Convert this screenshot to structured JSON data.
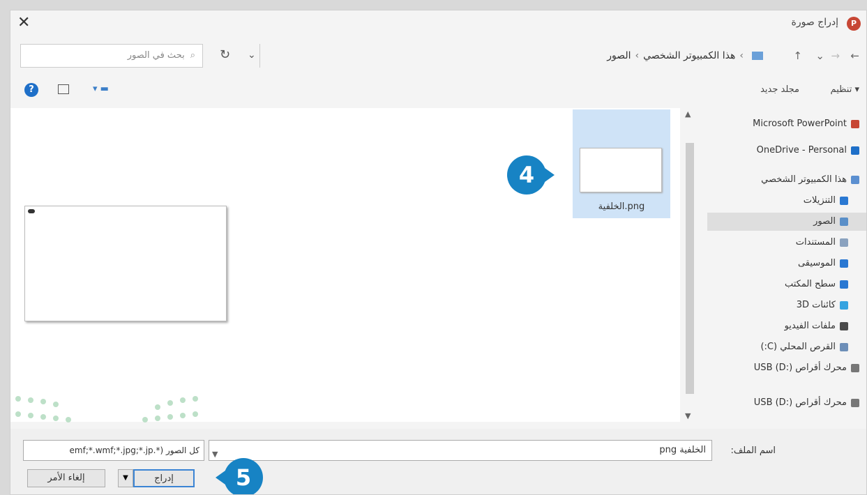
{
  "window": {
    "title": "إدراج صورة",
    "app_icon": "powerpoint-icon",
    "close_glyph": "✕"
  },
  "address": {
    "back": "←",
    "forward": "→",
    "recent": "⌄",
    "up": "↑",
    "path": [
      "هذا الكمبيوتر الشخصي",
      "الصور"
    ],
    "separator": "›",
    "dropdown": "⌄",
    "refresh": "↻",
    "search_placeholder": "بحث في الصور",
    "search_icon": "⌕"
  },
  "toolbar": {
    "organize": "تنظيم ▾",
    "new_folder": "مجلد جديد",
    "help": "?",
    "view_chevron": "▾"
  },
  "sidebar": {
    "items": [
      {
        "label": "Microsoft PowerPoint",
        "icon": "powerpoint-icon",
        "color": "#c74634"
      },
      {
        "label": "OneDrive - Personal",
        "icon": "cloud-icon",
        "color": "#1e6fc8"
      },
      {
        "label": "هذا الكمبيوتر الشخصي",
        "icon": "computer-icon",
        "color": "#5b8fd0"
      },
      {
        "label": "التنزيلات",
        "icon": "download-icon",
        "color": "#2a78d2"
      },
      {
        "label": "الصور",
        "icon": "pictures-icon",
        "color": "#5a8fc8",
        "selected": true
      },
      {
        "label": "المستندات",
        "icon": "document-icon",
        "color": "#8aa2bf"
      },
      {
        "label": "الموسيقى",
        "icon": "music-icon",
        "color": "#2a78d2"
      },
      {
        "label": "سطح المكتب",
        "icon": "desktop-icon",
        "color": "#2a78d2"
      },
      {
        "label": "كائنات 3D",
        "icon": "cube-icon",
        "color": "#36a3e0"
      },
      {
        "label": "ملفات الفيديو",
        "icon": "video-icon",
        "color": "#4a4a4a"
      },
      {
        "label": "القرص المحلي (C:)",
        "icon": "drive-icon",
        "color": "#6d8fb8"
      },
      {
        "label": "محرك أقراص USB (D:)",
        "icon": "usb-drive-icon",
        "color": "#777777"
      },
      {
        "label": "محرك أقراص USB (D:)",
        "icon": "usb-drive-icon",
        "color": "#777777"
      }
    ]
  },
  "files": {
    "selected_file": "الخلفية.png"
  },
  "badges": {
    "step4": "4",
    "step5": "5",
    "color": "#1783c4"
  },
  "footer": {
    "filename_label": "اسم الملف:",
    "filename_value": "الخلفية png",
    "filter_value": "كل الصور (*.emf;*.wmf;*.jpg;*.jp",
    "insert": "إدراج",
    "cancel": "إلغاء الأمر"
  }
}
